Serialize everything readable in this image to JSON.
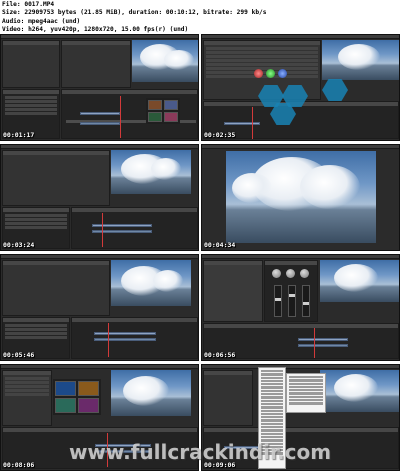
{
  "header": {
    "line1": "File: 0017.MP4",
    "line2": "Size: 22909753 bytes (21.85 MiB), duration: 00:10:12, bitrate: 299 kb/s",
    "line3": "Audio: mpeg4aac (und)",
    "line4": "Video: h264, yuv420p, 1280x720, 15.00 fps(r) (und)"
  },
  "frames": [
    {
      "timecode": "00:01:17"
    },
    {
      "timecode": "00:02:35"
    },
    {
      "timecode": "00:03:24"
    },
    {
      "timecode": "00:04:34"
    },
    {
      "timecode": "00:05:46"
    },
    {
      "timecode": "00:06:56"
    },
    {
      "timecode": "00:08:06"
    },
    {
      "timecode": "00:09:06"
    }
  ],
  "watermark": "www.fullcrackindir.com",
  "colors": {
    "ui_background": "#2b2b2b",
    "panel": "#333333",
    "clip": "#8ea3c2",
    "playhead": "#d23a3a",
    "hex_overlay": "#1982b4"
  }
}
